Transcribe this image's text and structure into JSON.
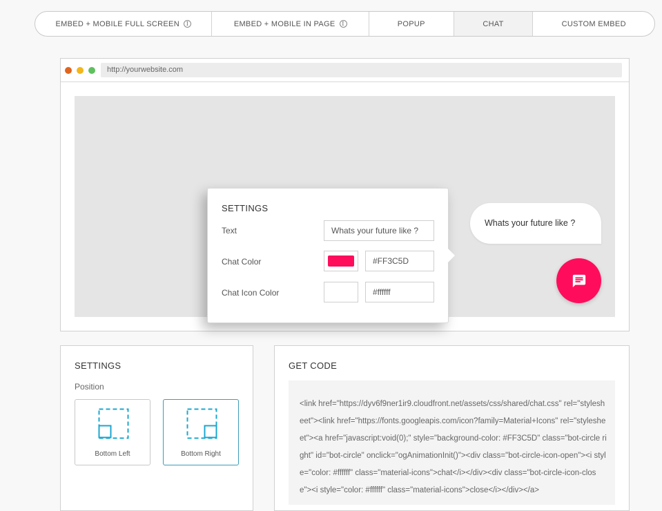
{
  "tabs": [
    {
      "label": "EMBED + MOBILE FULL SCREEN",
      "info": "i"
    },
    {
      "label": "EMBED + MOBILE IN PAGE",
      "info": "i"
    },
    {
      "label": "POPUP"
    },
    {
      "label": "CHAT",
      "active": true
    },
    {
      "label": "CUSTOM EMBED"
    }
  ],
  "browser": {
    "url": "http://yourwebsite.com"
  },
  "popup_settings": {
    "title": "SETTINGS",
    "text_label": "Text",
    "text_value": "Whats your future like ?",
    "chat_color_label": "Chat Color",
    "chat_color_value": "#FF3C5D",
    "chat_icon_color_label": "Chat Icon Color",
    "chat_icon_color_value": "#ffffff"
  },
  "chat_preview": {
    "bubble_text": "Whats your future like ?",
    "button_color": "#FF0D5C",
    "icon": "chat-icon"
  },
  "settings_panel": {
    "title": "SETTINGS",
    "position_label": "Position",
    "options": [
      {
        "label": "Bottom Left",
        "selected": false
      },
      {
        "label": "Bottom Right",
        "selected": true
      }
    ]
  },
  "code_panel": {
    "title": "GET CODE",
    "code": "<link href=\"https://dyv6f9ner1ir9.cloudfront.net/assets/css/shared/chat.css\" rel=\"stylesheet\"><link href=\"https://fonts.googleapis.com/icon?family=Material+Icons\" rel=\"stylesheet\"><a href=\"javascript:void(0);\" style=\"background-color: #FF3C5D\" class=\"bot-circle right\" id=\"bot-circle\" onclick=\"ogAnimationInit()\"><div class=\"bot-circle-icon-open\"><i style=\"color: #ffffff\" class=\"material-icons\">chat</i></div><div class=\"bot-circle-icon-close\"><i style=\"color: #ffffff\" class=\"material-icons\">close</i></div></a>"
  },
  "colors": {
    "accent": "#FF0D5C",
    "selected_border": "#3a9bb8",
    "position_icon": "#1aa7cf"
  }
}
